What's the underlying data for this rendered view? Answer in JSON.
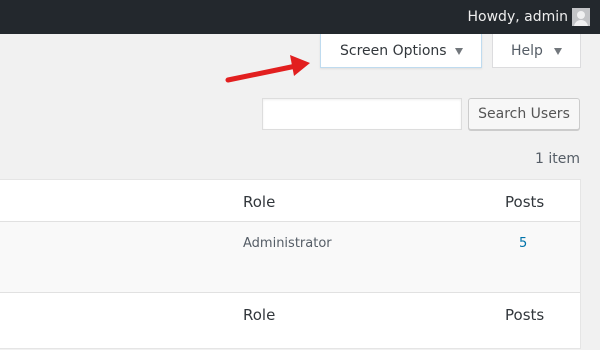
{
  "admin_bar": {
    "greeting": "Howdy, admin",
    "avatar_icon": "user-avatar-icon",
    "background": "#23282d"
  },
  "screen_meta": {
    "screen_options_label": "Screen Options",
    "help_label": "Help",
    "caret_icon": "caret-down-icon"
  },
  "annotation": {
    "arrow_color": "#e21f1f",
    "arrow_icon": "red-arrow-icon"
  },
  "search": {
    "input_value": "",
    "button_label": "Search Users"
  },
  "list": {
    "item_count": "1 item",
    "columns": {
      "role": "Role",
      "posts": "Posts"
    },
    "rows": [
      {
        "role": "Administrator",
        "posts": "5"
      }
    ],
    "link_color": "#0073aa"
  }
}
